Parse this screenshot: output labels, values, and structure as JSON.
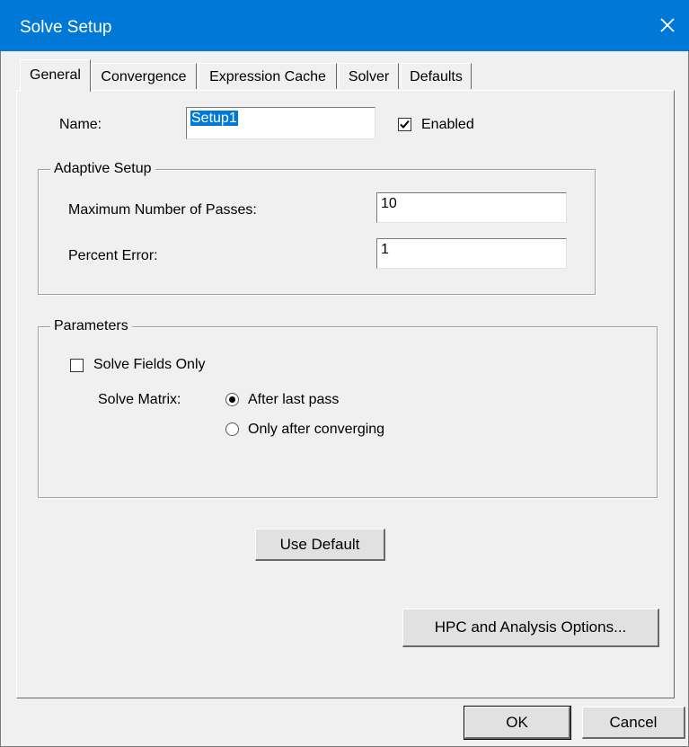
{
  "window": {
    "title": "Solve Setup",
    "close_icon": "close-icon"
  },
  "tabs": [
    {
      "label": "General",
      "active": true
    },
    {
      "label": "Convergence",
      "active": false
    },
    {
      "label": "Expression Cache",
      "active": false
    },
    {
      "label": "Solver",
      "active": false
    },
    {
      "label": "Defaults",
      "active": false
    }
  ],
  "general": {
    "name_label": "Name:",
    "name_value": "Setup1",
    "enabled_label": "Enabled",
    "enabled_checked": true
  },
  "adaptive": {
    "title": "Adaptive Setup",
    "max_passes_label": "Maximum Number of Passes:",
    "max_passes_value": "10",
    "percent_error_label": "Percent Error:",
    "percent_error_value": "1"
  },
  "parameters": {
    "title": "Parameters",
    "solve_fields_only_label": "Solve Fields Only",
    "solve_fields_only_checked": false,
    "solve_matrix_label": "Solve Matrix:",
    "options": [
      {
        "label": "After last pass",
        "selected": true
      },
      {
        "label": "Only after converging",
        "selected": false
      }
    ]
  },
  "buttons": {
    "use_default": "Use Default",
    "hpc": "HPC and Analysis Options...",
    "ok": "OK",
    "cancel": "Cancel"
  },
  "colors": {
    "titlebar": "#0078d7",
    "face": "#f0f0f0",
    "selection": "#0078d7"
  }
}
